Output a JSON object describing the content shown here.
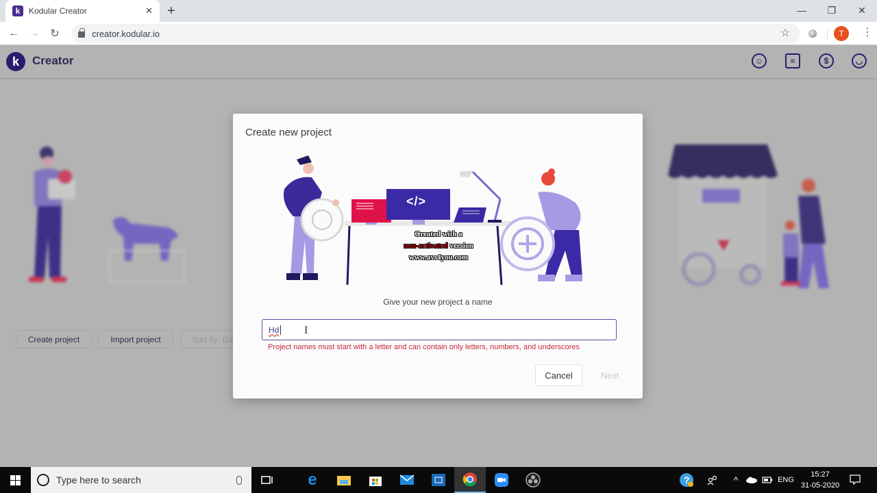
{
  "browser": {
    "tab_title": "Kodular Creator",
    "tab_favicon": "k",
    "new_tab_icon": "+",
    "url": "creator.kodular.io",
    "profile_initial": "T",
    "window_controls": {
      "minimize": "—",
      "restore": "❐",
      "close": "✕"
    },
    "nav": {
      "back": "←",
      "forward": "→",
      "reload": "↻",
      "bookmark": "☆",
      "menu": "⋮"
    }
  },
  "app": {
    "logo_letter": "k",
    "brand": "Creator",
    "header_icons": [
      "community-icon",
      "docs-icon",
      "billing-icon",
      "account-icon"
    ],
    "header_glyphs": {
      "community": "☺",
      "docs": "≡",
      "billing": "$",
      "account": "◡"
    },
    "toolbar": {
      "create_project": "Create project",
      "import_project": "Import project",
      "sort_by": "Sort by: Da"
    }
  },
  "dialog": {
    "title": "Create new project",
    "prompt": "Give your new project a name",
    "input_value": "Hd",
    "error": "Project names must start with a letter and can contain only letters, numbers, and underscores",
    "cancel_label": "Cancel",
    "next_label": "Next",
    "code_symbol": "</>",
    "watermark": {
      "line1": "Created with a",
      "line2_red": "non-activated",
      "line2_rest": " version",
      "line3": "www.avs4you.com"
    }
  },
  "taskbar": {
    "search_placeholder": "Type here to search",
    "apps": [
      "task-view",
      "edge",
      "file-explorer",
      "store",
      "mail",
      "app-6",
      "chrome",
      "zoom",
      "obs"
    ],
    "tray": {
      "language": "ENG",
      "chevron": "^"
    },
    "time": "15:27",
    "date": "31-05-2020"
  },
  "colors": {
    "brand": "#2c1b6e",
    "accent_purple": "#4b3ac8",
    "error": "#c8283a",
    "profile": "#e8501f"
  }
}
